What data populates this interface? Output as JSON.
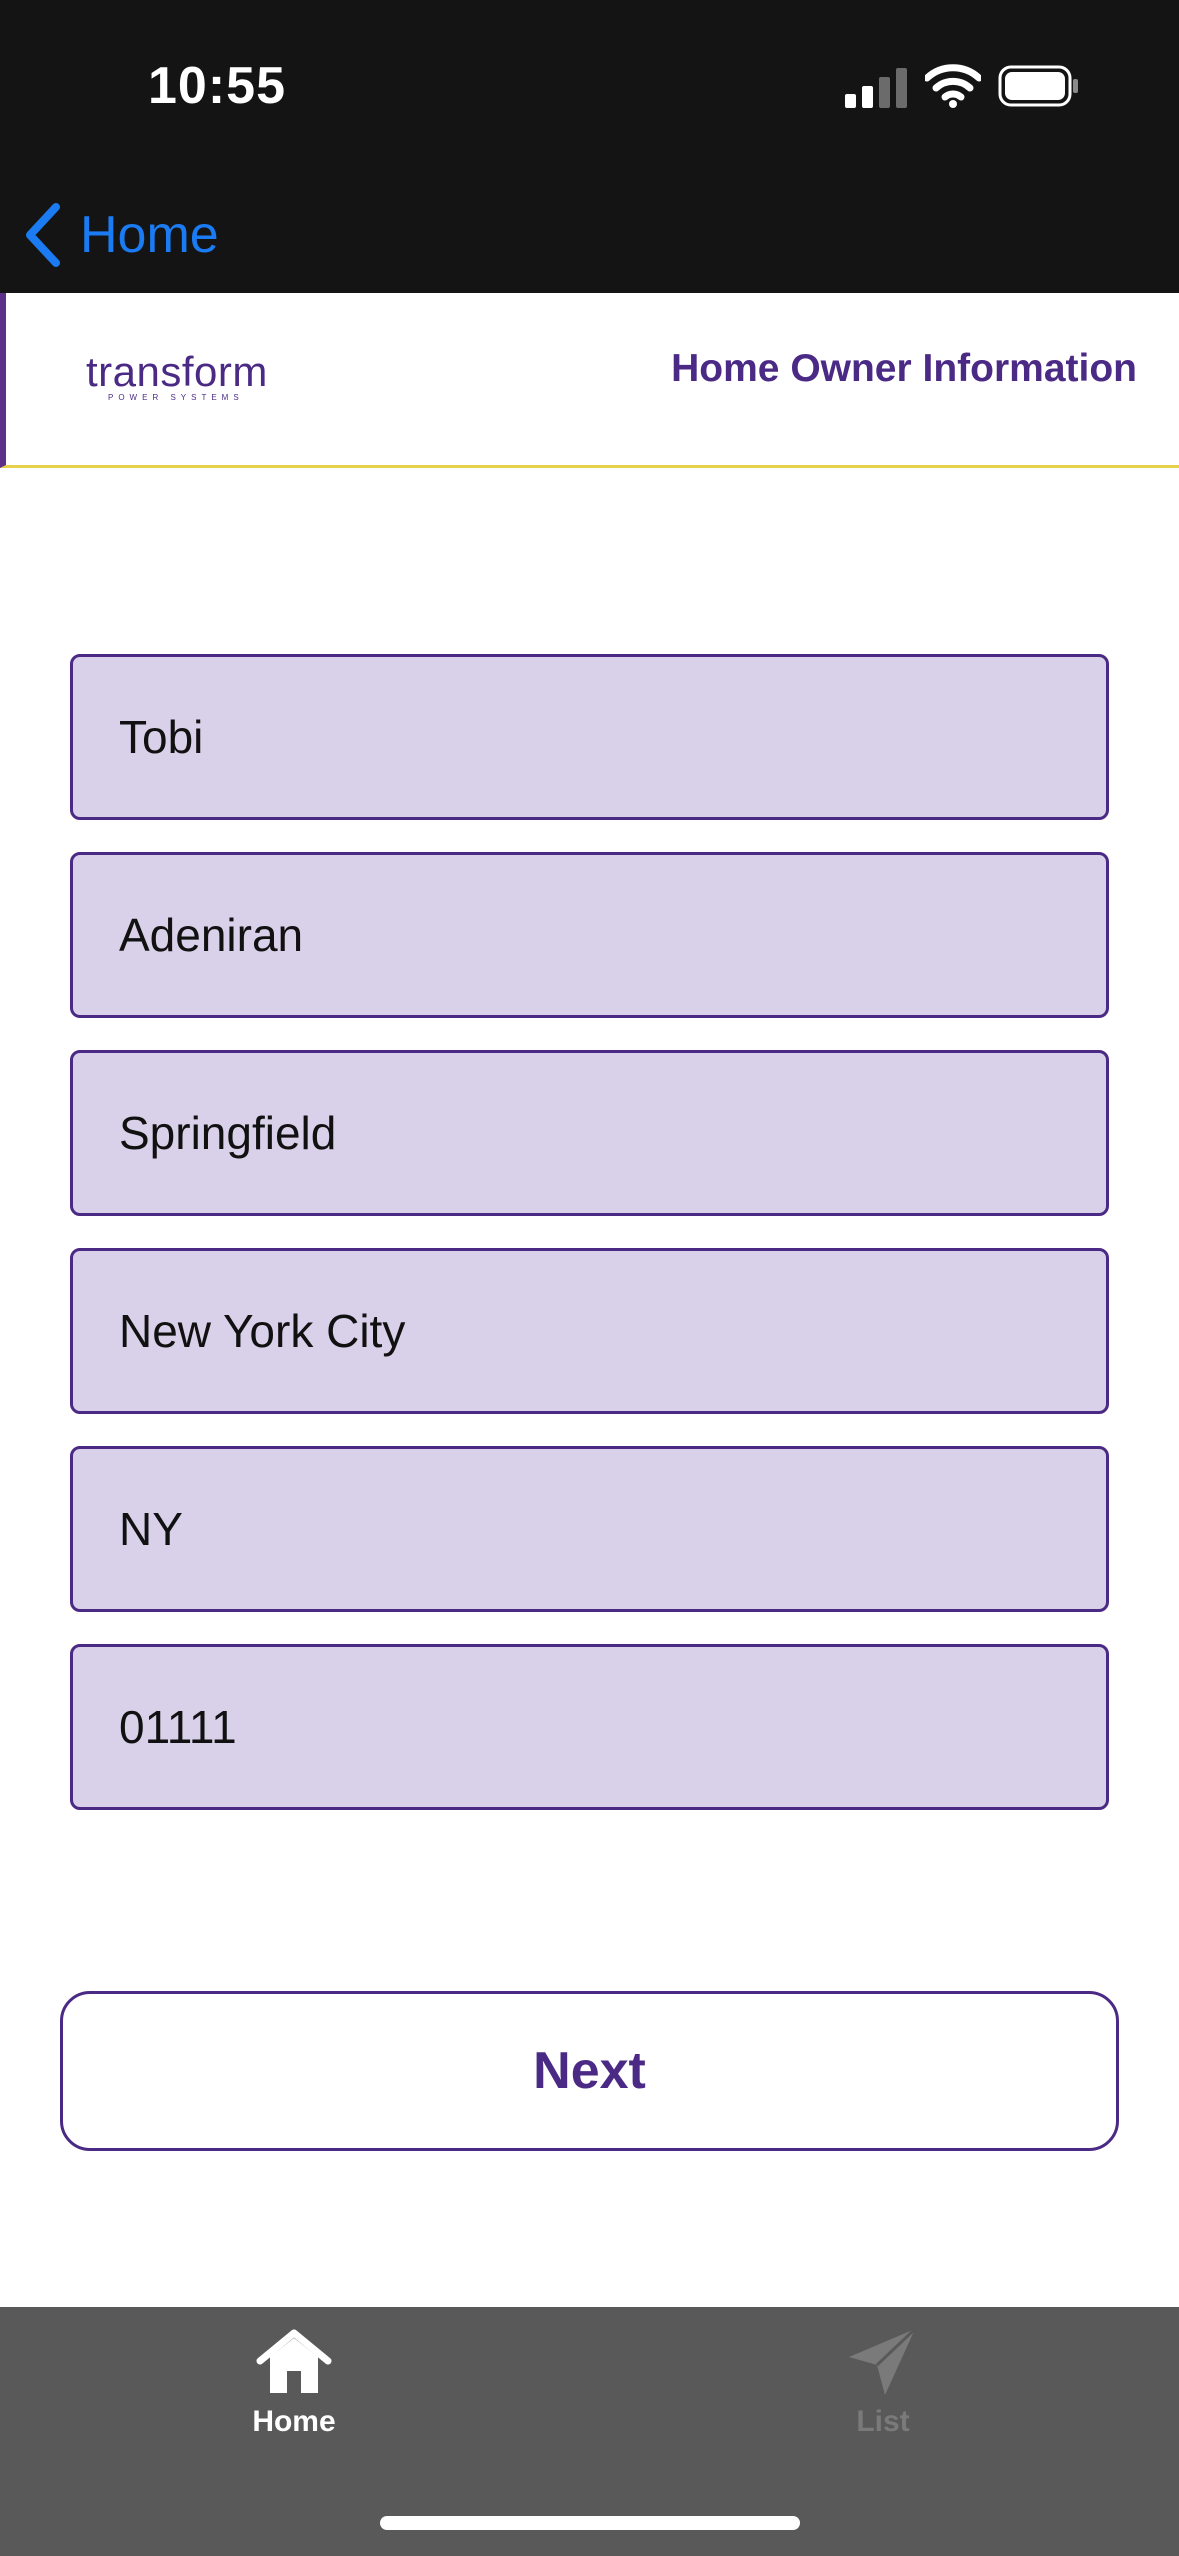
{
  "status_bar": {
    "time": "10:55"
  },
  "nav": {
    "back_label": "Home"
  },
  "header": {
    "logo_text": "transform",
    "logo_subtext": "POWER SYSTEMS",
    "title": "Home Owner Information"
  },
  "form": {
    "fields": [
      {
        "value": "Tobi"
      },
      {
        "value": "Adeniran"
      },
      {
        "value": "Springfield"
      },
      {
        "value": "New York City"
      },
      {
        "value": "NY"
      },
      {
        "value": "01111"
      }
    ],
    "next_label": "Next"
  },
  "tab_bar": {
    "tabs": [
      {
        "label": "Home",
        "icon": "home-icon",
        "active": true
      },
      {
        "label": "List",
        "icon": "paper-plane-icon",
        "active": false
      }
    ]
  },
  "colors": {
    "accent": "#4b2a86",
    "field_bg": "#d9d0ea",
    "link_blue": "#1b7bf2",
    "header_divider": "#e6d24a",
    "tab_bar_bg": "#595959"
  }
}
